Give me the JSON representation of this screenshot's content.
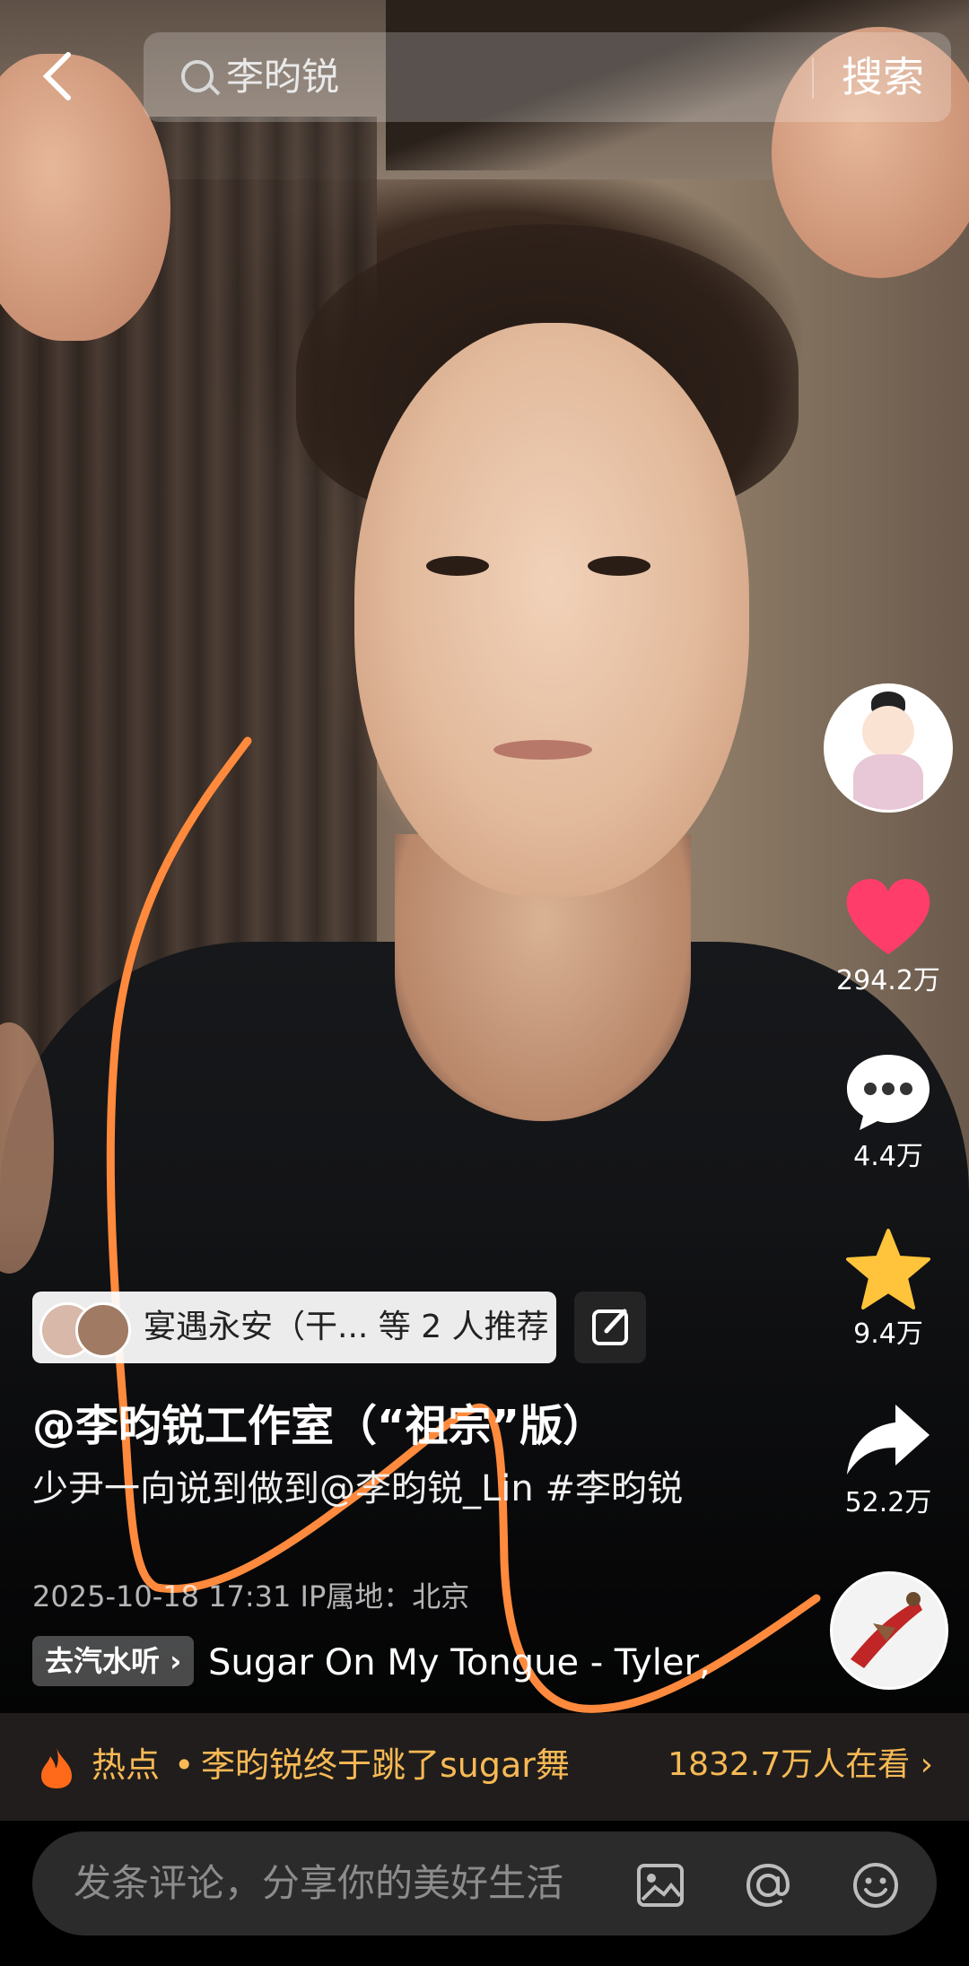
{
  "search": {
    "query": "李昀锐",
    "button_label": "搜索"
  },
  "rail": {
    "like_count": "294.2万",
    "comment_count": "4.4万",
    "favorite_count": "9.4万",
    "share_count": "52.2万"
  },
  "recommend": {
    "text": "宴遇永安（干... 等 2 人推荐"
  },
  "caption": {
    "title": "@李昀锐工作室（“祖宗”版）",
    "description": "少尹一向说到做到@李昀锐_Lin #李昀锐",
    "meta": "2025-10-18 17:31  IP属地：北京"
  },
  "music": {
    "chip_label": "去汽水听 ›",
    "track": "Sugar On My Tongue - Tyler,"
  },
  "hot": {
    "label": "热点",
    "dot": "•",
    "topic": "李昀锐终于跳了sugar舞",
    "watching": "1832.7万人在看  ›"
  },
  "comment": {
    "placeholder": "发条评论，分享你的美好生活"
  },
  "icons": {
    "back": "back-arrow-icon",
    "search": "search-icon",
    "like": "heart-icon",
    "comment": "comment-bubble-icon",
    "favorite": "star-icon",
    "share": "share-arrow-icon",
    "fire": "fire-icon",
    "image": "image-icon",
    "mention": "at-icon",
    "emoji": "emoji-icon",
    "edit": "edit-icon"
  },
  "colors": {
    "like": "#ff3d6b",
    "favorite": "#ffc43b",
    "hot_text": "#f7b955",
    "scribble": "#ff8a3d"
  }
}
